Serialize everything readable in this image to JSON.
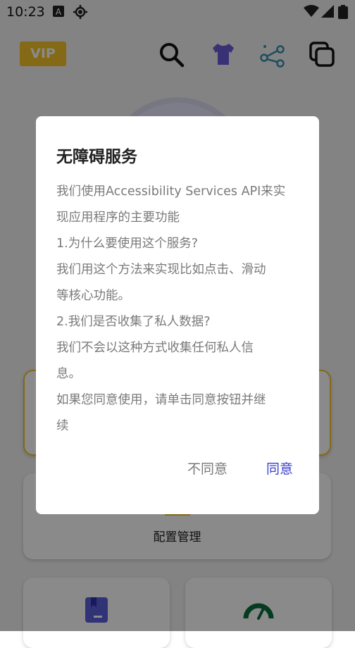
{
  "status_bar": {
    "time": "10:23"
  },
  "header": {
    "vip_label": "VIP"
  },
  "cards": {
    "config_label": "配置管理"
  },
  "dialog": {
    "title": "无障碍服务",
    "lines": [
      "我们使用Accessibility Services API来实",
      "现应用程序的主要功能",
      "1.为什么要使用这个服务?",
      "我们用这个方法来实现比如点击、滑动",
      "等核心功能。",
      "2.我们是否收集了私人数据?",
      "我们不会以这种方式收集任何私人信",
      "息。",
      "如果您同意使用，请单击同意按钮并继",
      "续"
    ],
    "deny_label": "不同意",
    "agree_label": "同意"
  },
  "colors": {
    "accent": "#3a40cf",
    "vip": "#f4c22c",
    "warn_border": "#f4c22c"
  },
  "icons": [
    "search-icon",
    "shirt-icon",
    "share-icon",
    "copy-icon",
    "bookmark-icon",
    "speedometer-icon"
  ]
}
